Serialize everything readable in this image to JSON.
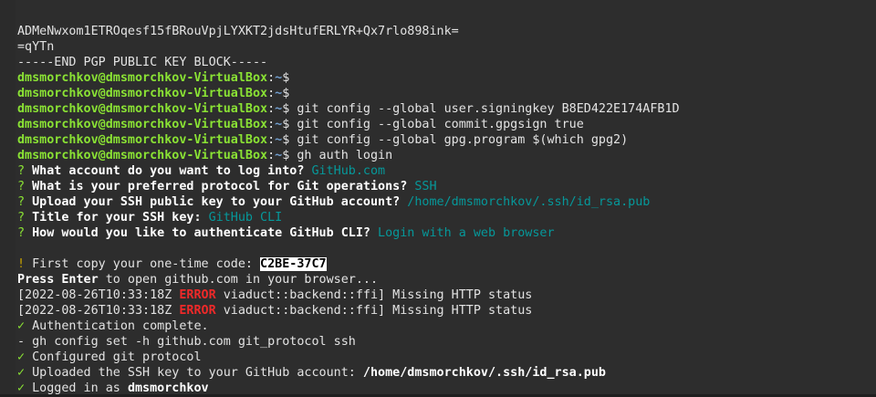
{
  "terminal": {
    "lines": [
      {
        "id": "key-tail",
        "parts": [
          {
            "text": "ADMeNwxom1ETROqesf15fBRouVpjLYXKT2jdsHtufERLYR+Qx7rlo898ink="
          }
        ]
      },
      {
        "id": "key-checksum",
        "parts": [
          {
            "text": "=qYTn"
          }
        ]
      },
      {
        "id": "key-end",
        "parts": [
          {
            "text": "-----END PGP PUBLIC KEY BLOCK-----"
          }
        ]
      },
      {
        "id": "prompt-1",
        "parts": [
          {
            "text": "dmsmorchkov@dmsmorchkov-VirtualBox",
            "cls": "green"
          },
          {
            "text": ":"
          },
          {
            "text": "~",
            "cls": "blue"
          },
          {
            "text": "$"
          }
        ]
      },
      {
        "id": "prompt-2",
        "parts": [
          {
            "text": "dmsmorchkov@dmsmorchkov-VirtualBox",
            "cls": "green"
          },
          {
            "text": ":"
          },
          {
            "text": "~",
            "cls": "blue"
          },
          {
            "text": "$"
          }
        ]
      },
      {
        "id": "cmd-signingkey",
        "parts": [
          {
            "text": "dmsmorchkov@dmsmorchkov-VirtualBox",
            "cls": "green"
          },
          {
            "text": ":"
          },
          {
            "text": "~",
            "cls": "blue"
          },
          {
            "text": "$ git config --global user.signingkey B8ED422E174AFB1D"
          }
        ]
      },
      {
        "id": "cmd-gpgsign",
        "parts": [
          {
            "text": "dmsmorchkov@dmsmorchkov-VirtualBox",
            "cls": "green"
          },
          {
            "text": ":"
          },
          {
            "text": "~",
            "cls": "blue"
          },
          {
            "text": "$ git config --global commit.gpgsign true"
          }
        ]
      },
      {
        "id": "cmd-gpgprogram",
        "parts": [
          {
            "text": "dmsmorchkov@dmsmorchkov-VirtualBox",
            "cls": "green"
          },
          {
            "text": ":"
          },
          {
            "text": "~",
            "cls": "blue"
          },
          {
            "text": "$ git config --global gpg.program $(which gpg2)"
          }
        ]
      },
      {
        "id": "cmd-gh-auth",
        "parts": [
          {
            "text": "dmsmorchkov@dmsmorchkov-VirtualBox",
            "cls": "green"
          },
          {
            "text": ":"
          },
          {
            "text": "~",
            "cls": "blue"
          },
          {
            "text": "$ gh auth login"
          }
        ]
      },
      {
        "id": "q-account",
        "parts": [
          {
            "text": "?",
            "cls": "q-mark"
          },
          {
            "text": " What account do you want to log into? ",
            "cls": "bold"
          },
          {
            "text": "GitHub.com",
            "cls": "cyan"
          }
        ]
      },
      {
        "id": "q-protocol",
        "parts": [
          {
            "text": "?",
            "cls": "q-mark"
          },
          {
            "text": " What is your preferred protocol for Git operations? ",
            "cls": "bold"
          },
          {
            "text": "SSH",
            "cls": "cyan"
          }
        ]
      },
      {
        "id": "q-upload-key",
        "parts": [
          {
            "text": "?",
            "cls": "q-mark"
          },
          {
            "text": " Upload your SSH public key to your GitHub account? ",
            "cls": "bold"
          },
          {
            "text": "/home/dmsmorchkov/.ssh/id_rsa.pub",
            "cls": "cyan"
          }
        ]
      },
      {
        "id": "q-title",
        "parts": [
          {
            "text": "?",
            "cls": "q-mark"
          },
          {
            "text": " Title for your SSH key: ",
            "cls": "bold"
          },
          {
            "text": "GitHub CLI",
            "cls": "cyan"
          }
        ]
      },
      {
        "id": "q-auth-method",
        "parts": [
          {
            "text": "?",
            "cls": "q-mark"
          },
          {
            "text": " How would you like to authenticate GitHub CLI? ",
            "cls": "bold"
          },
          {
            "text": "Login with a web browser",
            "cls": "cyan"
          }
        ]
      },
      {
        "id": "blank-1",
        "parts": [
          {
            "text": ""
          }
        ]
      },
      {
        "id": "one-time-code",
        "parts": [
          {
            "text": "!",
            "cls": "yellow"
          },
          {
            "text": " First copy your one-time code: "
          },
          {
            "text": "C2BE-37C7",
            "cls": "code-hl"
          }
        ]
      },
      {
        "id": "press-enter",
        "parts": [
          {
            "text": "Press Enter",
            "cls": "bold"
          },
          {
            "text": " to open github.com in your browser..."
          }
        ]
      },
      {
        "id": "error-1",
        "parts": [
          {
            "text": "[2022-08-26T10:33:18Z "
          },
          {
            "text": "ERROR",
            "cls": "red"
          },
          {
            "text": " viaduct::backend::ffi] Missing HTTP status"
          }
        ]
      },
      {
        "id": "error-2",
        "parts": [
          {
            "text": "[2022-08-26T10:33:18Z "
          },
          {
            "text": "ERROR",
            "cls": "red"
          },
          {
            "text": " viaduct::backend::ffi] Missing HTTP status"
          }
        ]
      },
      {
        "id": "auth-complete",
        "parts": [
          {
            "text": "✓",
            "cls": "q-mark"
          },
          {
            "text": " Authentication complete."
          }
        ]
      },
      {
        "id": "config-set",
        "parts": [
          {
            "text": "- gh config set -h github.com git_protocol ssh"
          }
        ]
      },
      {
        "id": "configured-protocol",
        "parts": [
          {
            "text": "✓",
            "cls": "q-mark"
          },
          {
            "text": " Configured git protocol"
          }
        ]
      },
      {
        "id": "uploaded-key",
        "parts": [
          {
            "text": "✓",
            "cls": "q-mark"
          },
          {
            "text": " Uploaded the SSH key to your GitHub account: "
          },
          {
            "text": "/home/dmsmorchkov/.ssh/id_rsa.pub",
            "cls": "bold"
          }
        ]
      },
      {
        "id": "logged-in",
        "parts": [
          {
            "text": "✓",
            "cls": "q-mark"
          },
          {
            "text": " Logged in as "
          },
          {
            "text": "dmsmorchkov",
            "cls": "bold"
          }
        ]
      },
      {
        "id": "prompt-final",
        "cursor": true,
        "parts": [
          {
            "text": "dmsmorchkov@dmsmorchkov-VirtualBox",
            "cls": "green"
          },
          {
            "text": ":"
          },
          {
            "text": "~",
            "cls": "blue"
          },
          {
            "text": "$ "
          }
        ]
      }
    ]
  }
}
